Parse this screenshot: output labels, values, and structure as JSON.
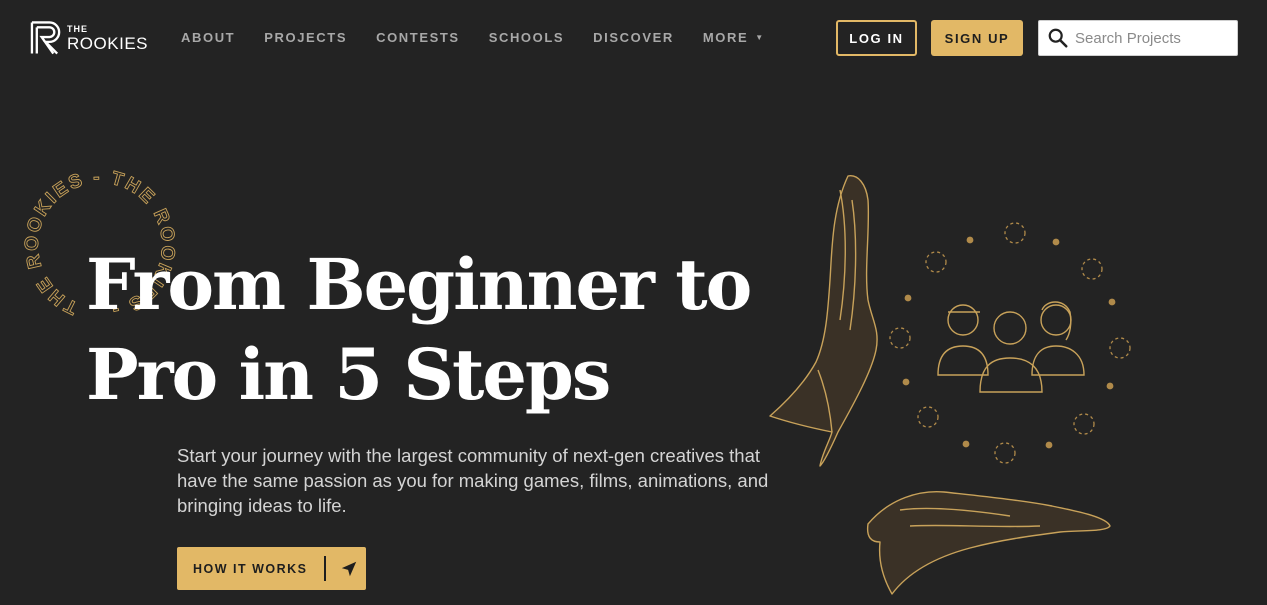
{
  "brand": {
    "the": "THE",
    "name": "ROOKIES"
  },
  "nav": {
    "items": [
      {
        "label": "ABOUT"
      },
      {
        "label": "PROJECTS"
      },
      {
        "label": "CONTESTS"
      },
      {
        "label": "SCHOOLS"
      },
      {
        "label": "DISCOVER"
      },
      {
        "label": "MORE"
      }
    ]
  },
  "auth": {
    "login_label": "LOG IN",
    "signup_label": "SIGN UP"
  },
  "search": {
    "placeholder": "Search Projects",
    "value": ""
  },
  "badge": {
    "text": "THE ROOKIES - THE ROOKIES - "
  },
  "hero": {
    "title_line1": "From Beginner to",
    "title_line2": "Pro in 5 Steps",
    "subtitle": "Start your journey with the largest community of next-gen creatives that have the same passion as you for making games, films, animations, and bringing ideas to life.",
    "cta_label": "HOW IT WORKS"
  },
  "colors": {
    "background": "#232323",
    "accent": "#e2b866",
    "nav_text": "#a8a8a8"
  },
  "icons": {
    "search": "search-icon",
    "cta": "navigation-arrow-icon",
    "more": "caret-down-icon"
  }
}
